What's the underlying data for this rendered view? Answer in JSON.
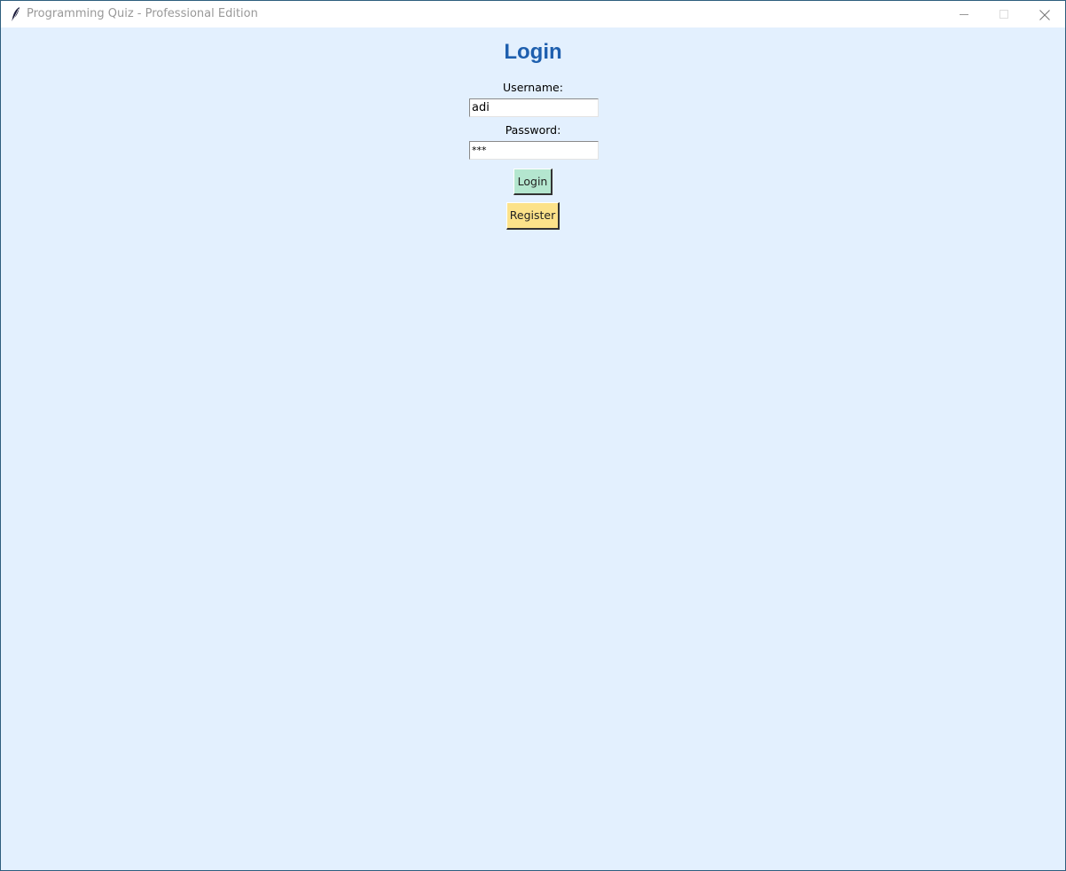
{
  "window": {
    "title": "Programming Quiz - Professional Edition",
    "app_icon": "feather-icon",
    "controls": {
      "minimize_icon": "minimize-icon",
      "maximize_icon": "maximize-icon",
      "close_icon": "close-icon"
    }
  },
  "login": {
    "heading": "Login",
    "username_label": "Username:",
    "username_value": "adi",
    "password_label": "Password:",
    "password_value": "***",
    "login_button": "Login",
    "register_button": "Register"
  },
  "colors": {
    "background": "#e3f0fe",
    "heading": "#1e5fae",
    "login_button": "#b4e6cf",
    "register_button": "#fce28a"
  }
}
